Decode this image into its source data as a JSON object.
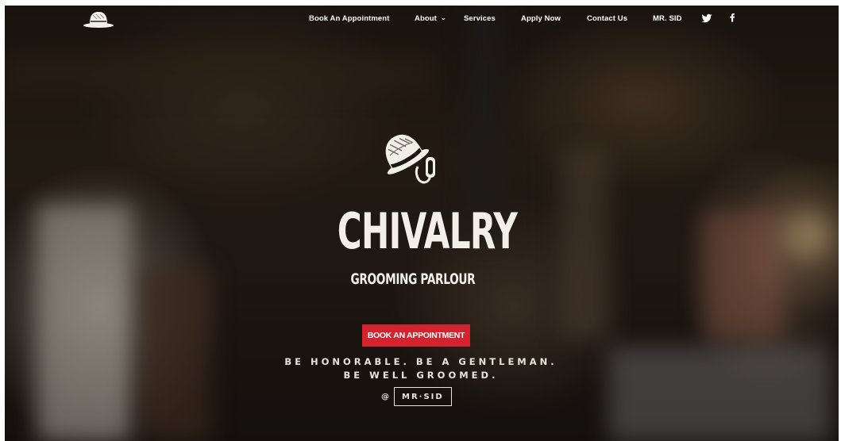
{
  "nav": {
    "items": [
      {
        "label": "Book An Appointment"
      },
      {
        "label": "About"
      },
      {
        "label": "Services"
      },
      {
        "label": "Apply Now"
      },
      {
        "label": "Contact Us"
      },
      {
        "label": "MR. SID"
      }
    ],
    "social": [
      "twitter-icon",
      "facebook-icon"
    ]
  },
  "hero": {
    "brand": "CHIVALRY",
    "subbrand": "GROOMING PARLOUR",
    "cta_label": "BOOK AN APPOINTMENT",
    "tagline_line1": "BE HONORABLE. BE A GENTLEMAN.",
    "tagline_line2": "BE WELL GROOMED.",
    "at_symbol": "@",
    "handle": "MR·SID"
  },
  "colors": {
    "accent": "#d2232f",
    "text": "#f2efe9"
  }
}
